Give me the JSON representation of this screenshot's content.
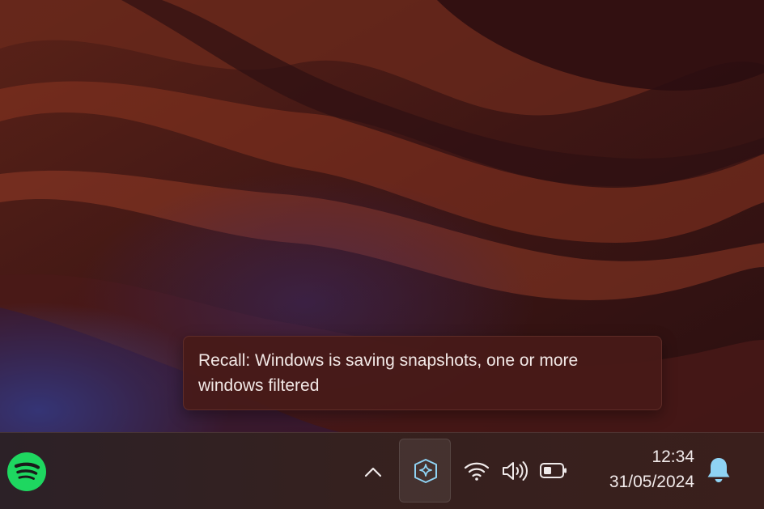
{
  "tooltip": {
    "text": "Recall: Windows is saving snapshots, one or more windows filtered"
  },
  "taskbar": {
    "apps": [
      {
        "name": "Spotify",
        "icon": "spotify-icon"
      }
    ],
    "tray": {
      "chevron_icon": "chevron-up-icon",
      "recall_icon": "recall-icon",
      "wifi_icon": "wifi-icon",
      "volume_icon": "volume-icon",
      "battery_icon": "battery-icon"
    },
    "clock": {
      "time": "12:34",
      "date": "31/05/2024"
    },
    "notifications_icon": "bell-icon"
  },
  "colors": {
    "spotify_green": "#1ed760",
    "recall_accent": "#8fd3f4",
    "bell_accent": "#8fd3f4"
  }
}
